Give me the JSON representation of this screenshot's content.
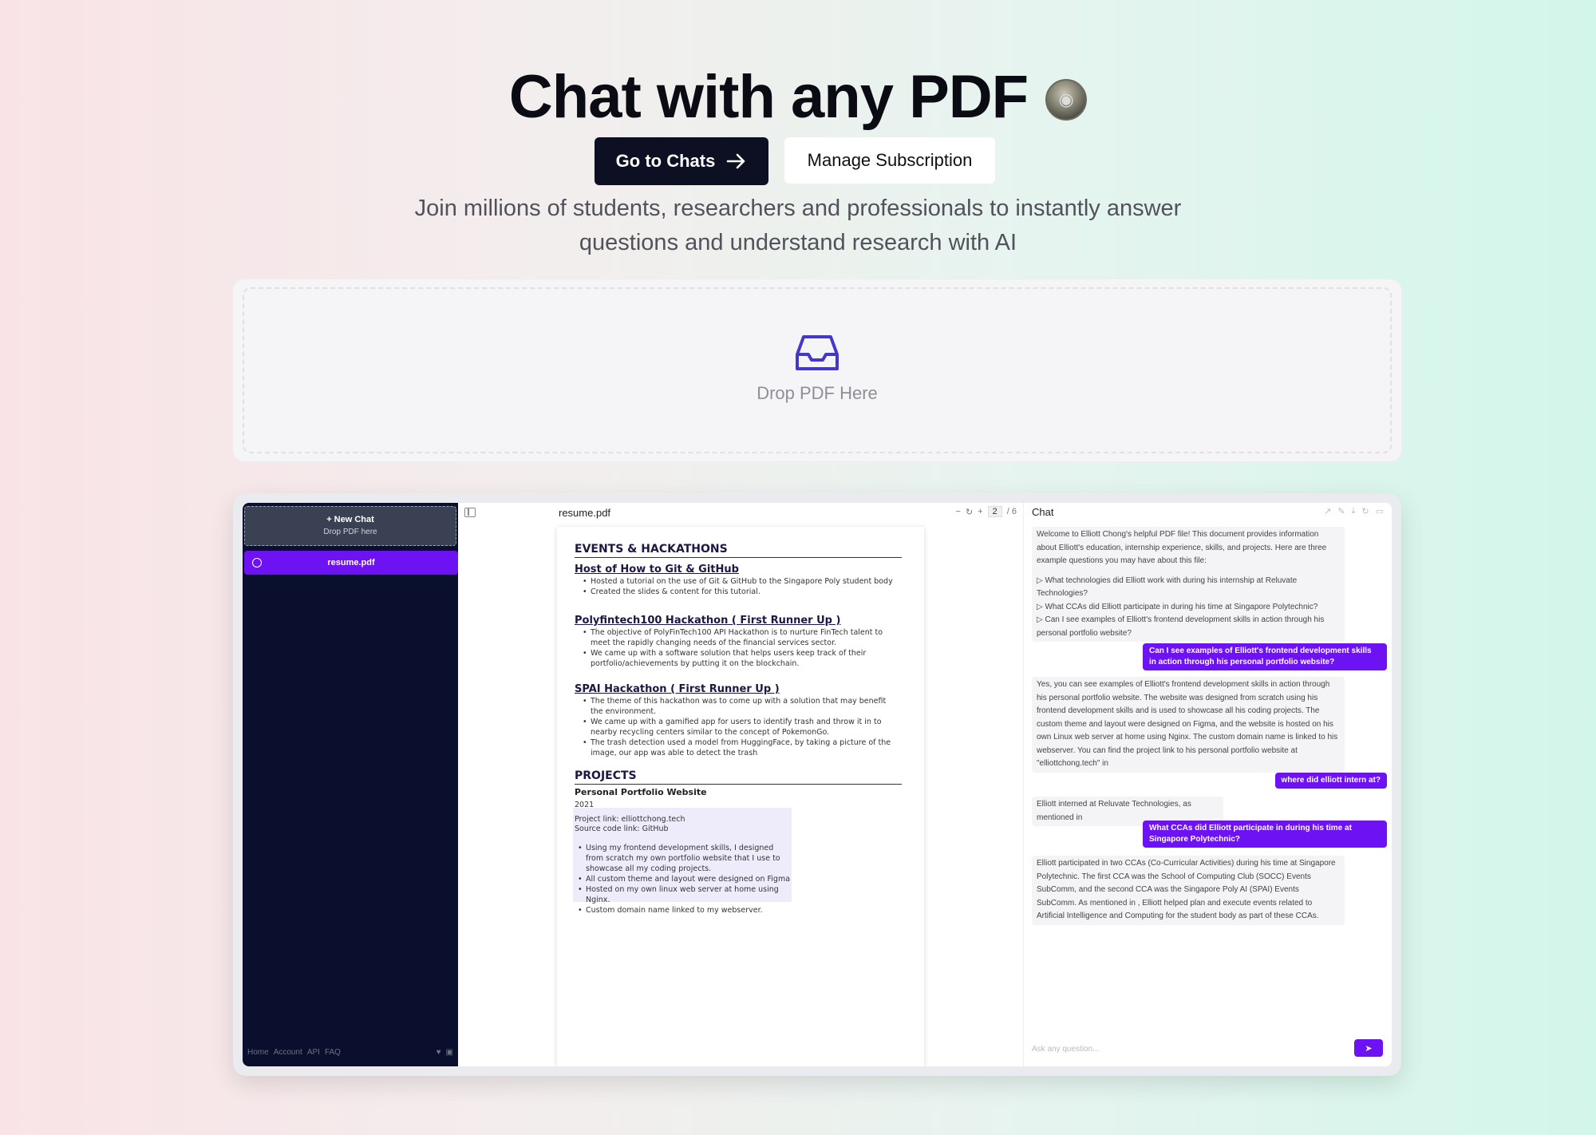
{
  "hero": {
    "title": "Chat with any PDF",
    "subtitle": "Join millions of students, researchers and professionals to instantly answer questions and understand research with AI"
  },
  "cta": {
    "primary_label": "Go to Chats",
    "secondary_label": "Manage Subscription"
  },
  "dropzone": {
    "label": "Drop PDF Here",
    "icon": "inbox-icon"
  },
  "preview": {
    "sidebar": {
      "new_chat_label": "+ New Chat",
      "new_chat_hint": "Drop PDF here",
      "chats": [
        {
          "label": "resume.pdf"
        }
      ],
      "footer_links": [
        "Home",
        "Account",
        "API",
        "FAQ"
      ]
    },
    "pdf": {
      "filename": "resume.pdf",
      "page_current": "2",
      "page_total": "/ 6",
      "sections": {
        "events": "EVENTS & HACKATHONS",
        "projects": "PROJECTS"
      },
      "entries": [
        {
          "title": "Host of How to Git & GitHub",
          "bullets": [
            "Hosted a tutorial on the use of Git & GitHub to the Singapore Poly student body",
            "Created the slides & content for this tutorial."
          ]
        },
        {
          "title": "Polyfintech100 Hackathon ( First Runner Up )",
          "bullets": [
            "The objective of PolyFinTech100 API Hackathon is to nurture FinTech talent to meet the rapidly changing needs of the financial services sector.",
            "We came up with a software solution that helps users keep track of their portfolio/achievements by putting it on the blockchain."
          ]
        },
        {
          "title": "SPAI Hackathon ( First Runner Up )",
          "bullets": [
            "The theme of this hackathon was to come up with a solution that may benefit the environment.",
            "We came up with a gamified app for users to identify trash and throw it in to nearby recycling centers similar to the concept of PokemonGo.",
            "The trash detection used a model from HuggingFace, by taking a picture of the image, our app was able to detect the trash"
          ]
        }
      ],
      "project": {
        "title": "Personal Portfolio Website",
        "year": "2021",
        "project_link": "Project link: elliottchong.tech",
        "source_link": "Source code link: GitHub",
        "bullets": [
          "Using my frontend development skills, I designed from scratch my own portfolio website that I use to showcase all my coding projects.",
          "All custom theme and layout were designed on Figma",
          "Hosted on my own linux web server at home using Nginx.",
          "Custom domain name linked to my webserver."
        ]
      }
    },
    "chat": {
      "title": "Chat",
      "messages": [
        {
          "role": "ai",
          "text": "Welcome to Elliott Chong's helpful PDF file! This document provides information about Elliott's education, internship experience, skills, and projects. Here are three example questions you may have about this file:"
        },
        {
          "role": "ai",
          "text": "▷ What technologies did Elliott work with during his internship at Reluvate Technologies?"
        },
        {
          "role": "ai",
          "text": "▷ What CCAs did Elliott participate in during his time at Singapore Polytechnic?"
        },
        {
          "role": "ai",
          "text": "▷ Can I see examples of Elliott's frontend development skills in action through his personal portfolio website?"
        },
        {
          "role": "user",
          "text": "Can I see examples of Elliott's frontend development skills in action through his personal portfolio website?"
        },
        {
          "role": "ai",
          "text": "Yes, you can see examples of Elliott's frontend development skills in action through his personal portfolio website. The website was designed from scratch using his frontend development skills and is used to showcase all his coding projects. The custom theme and layout were designed on Figma, and the website is hosted on his own Linux web server at home using Nginx. The custom domain name is linked to his webserver. You can find the project link to his personal portfolio website at \"elliottchong.tech\" in"
        },
        {
          "role": "user",
          "text": "where did elliott intern at?"
        },
        {
          "role": "ai",
          "text": "Elliott interned at Reluvate Technologies, as mentioned in"
        },
        {
          "role": "user",
          "text": "What CCAs did Elliott participate in during his time at Singapore Polytechnic?"
        },
        {
          "role": "ai",
          "text": "Elliott participated in two CCAs (Co-Curricular Activities) during his time at Singapore Polytechnic. The first CCA was the School of Computing Club (SOCC) Events SubComm, and the second CCA was the Singapore Poly AI (SPAI) Events SubComm. As mentioned in , Elliott helped plan and execute events related to Artificial Intelligence and Computing for the student body as part of these CCAs."
        }
      ],
      "input_placeholder": "Ask any question..."
    }
  }
}
